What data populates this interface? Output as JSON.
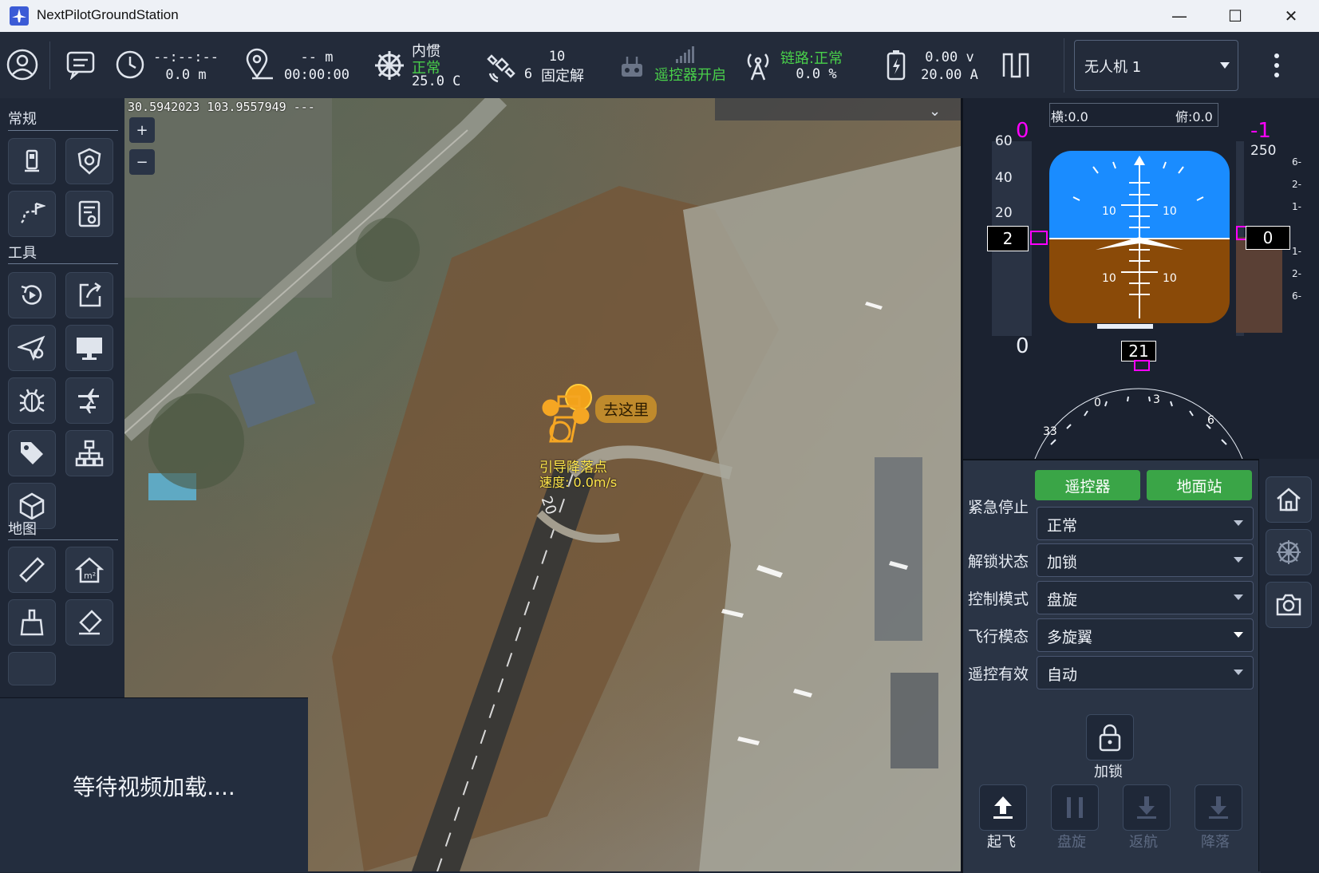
{
  "window": {
    "title": "NextPilotGroundStation",
    "minimize": "—",
    "maximize": "☐",
    "close": "✕"
  },
  "toolbar": {
    "time": "--:--:--",
    "altitude": "0.0 m",
    "distance": "-- m",
    "flight_time": "00:00:00",
    "ins_label": "内惯",
    "ins_status": "正常",
    "temperature": "25.0 C",
    "gps_count": "10",
    "gps_sats": "6",
    "gps_fix": "固定解",
    "rc_status": "遥控器开启",
    "link_label": "链路:正常",
    "link_percent": "0.0 %",
    "voltage": "0.00 v",
    "current": "20.00 A",
    "vehicle_select": "无人机 1"
  },
  "sidebar": {
    "section_general": "常规",
    "section_tools": "工具",
    "section_map": "地图"
  },
  "map": {
    "coordinates": "30.5942023  103.9557949  ---",
    "zoom_in": "+",
    "zoom_out": "−",
    "goto_label": "去这里",
    "guide_label": "引导降落点",
    "speed_label": "速度: 0.0m/s",
    "runway_number": "20"
  },
  "video": {
    "message": "等待视频加载...."
  },
  "attitude": {
    "roll_label": "横:0.0",
    "pitch_label": "俯:0.0",
    "left_magenta": "0",
    "right_magenta": "-1",
    "speed_value": "2",
    "alt_value": "0",
    "heading_value": "21",
    "speed_ticks": [
      "60",
      "40",
      "20"
    ],
    "speed_bottom": "0",
    "alt_top": "250",
    "vs_ticks": [
      "6-",
      "2-",
      "1-",
      "1-",
      "2-",
      "6-"
    ],
    "pitch_ticks": [
      "10",
      "10",
      "10",
      "10"
    ],
    "heading_ticks": [
      "33",
      "0",
      "3",
      "6"
    ]
  },
  "control": {
    "rc_button": "遥控器",
    "gcs_button": "地面站",
    "emergency_label": "紧急停止",
    "emergency_value": "正常",
    "lock_label": "解锁状态",
    "lock_value": "加锁",
    "mode_label": "控制模式",
    "mode_value": "盘旋",
    "state_label": "飞行模态",
    "state_value": "多旋翼",
    "rc_valid_label": "遥控有效",
    "rc_valid_value": "自动",
    "lock_button": "加锁",
    "takeoff": "起飞",
    "loiter": "盘旋",
    "rtl": "返航",
    "land": "降落"
  },
  "colors": {
    "accent_green": "#3aa547",
    "sky": "#1a8cff",
    "ground": "#8a4a08",
    "magenta": "#ff00ff"
  }
}
